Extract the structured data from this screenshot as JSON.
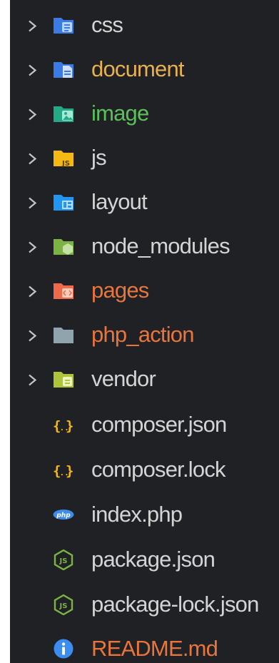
{
  "explorer": {
    "items": [
      {
        "label": "css",
        "type": "folder",
        "icon": "css-folder-icon",
        "color": "#d4d4d4",
        "icon_color": "#3b7be6"
      },
      {
        "label": "document",
        "type": "folder",
        "icon": "document-folder-icon",
        "color": "#e8b04e",
        "icon_color": "#3b7be6"
      },
      {
        "label": "image",
        "type": "folder",
        "icon": "image-folder-icon",
        "color": "#5cc05a",
        "icon_color": "#25a886"
      },
      {
        "label": "js",
        "type": "folder",
        "icon": "js-folder-icon",
        "color": "#d4d4d4",
        "icon_color": "#f5b915"
      },
      {
        "label": "layout",
        "type": "folder",
        "icon": "layout-folder-icon",
        "color": "#d4d4d4",
        "icon_color": "#2196f3"
      },
      {
        "label": "node_modules",
        "type": "folder",
        "icon": "node-modules-folder-icon",
        "color": "#d4d4d4",
        "icon_color": "#7cb342"
      },
      {
        "label": "pages",
        "type": "folder",
        "icon": "pages-folder-icon",
        "color": "#e8763c",
        "icon_color": "#ef6a4a"
      },
      {
        "label": "php_action",
        "type": "folder",
        "icon": "folder-icon",
        "color": "#e8763c",
        "icon_color": "#90a4ae"
      },
      {
        "label": "vendor",
        "type": "folder",
        "icon": "vendor-folder-icon",
        "color": "#d4d4d4",
        "icon_color": "#b0c43a"
      },
      {
        "label": "composer.json",
        "type": "file",
        "icon": "json-braces-icon",
        "color": "#d4d4d4",
        "icon_color": "#f5b915"
      },
      {
        "label": "composer.lock",
        "type": "file",
        "icon": "json-braces-icon",
        "color": "#d4d4d4",
        "icon_color": "#f5b915"
      },
      {
        "label": "index.php",
        "type": "file",
        "icon": "php-icon",
        "color": "#d4d4d4",
        "icon_color": "#3f8ce8"
      },
      {
        "label": "package.json",
        "type": "file",
        "icon": "nodejs-icon",
        "color": "#d4d4d4",
        "icon_color": "#7cb342"
      },
      {
        "label": "package-lock.json",
        "type": "file",
        "icon": "nodejs-icon",
        "color": "#d4d4d4",
        "icon_color": "#7cb342"
      },
      {
        "label": "README.md",
        "type": "file",
        "icon": "info-icon",
        "color": "#e8763c",
        "icon_color": "#3b8ef0"
      }
    ]
  }
}
